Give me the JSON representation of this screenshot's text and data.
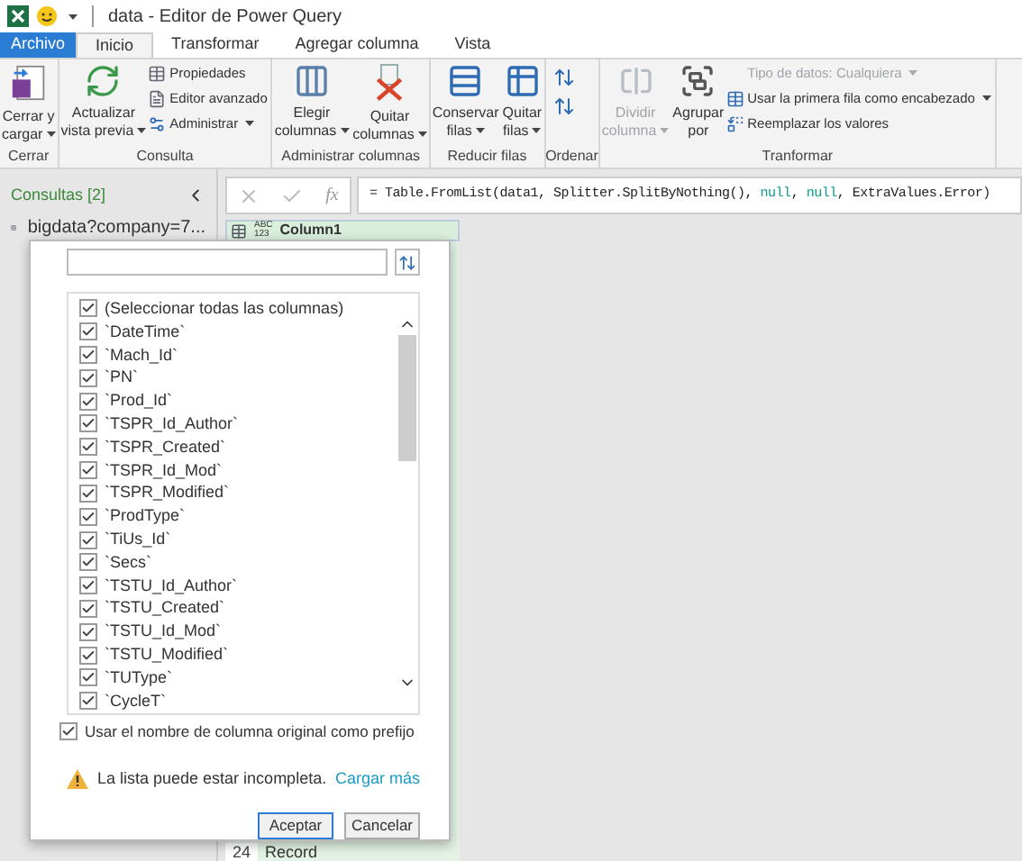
{
  "window": {
    "title": "data - Editor de Power Query"
  },
  "tabs": [
    {
      "label": "Archivo",
      "kind": "file",
      "selected": false
    },
    {
      "label": "Inicio",
      "kind": "tab",
      "selected": true
    },
    {
      "label": "Transformar",
      "kind": "tab",
      "selected": false
    },
    {
      "label": "Agregar columna",
      "kind": "tab",
      "selected": false
    },
    {
      "label": "Vista",
      "kind": "tab",
      "selected": false
    }
  ],
  "ribbon_groups": [
    {
      "label": "Cerrar",
      "buttons": [
        {
          "kind": "large",
          "lines": [
            "Cerrar y",
            "cargar"
          ],
          "dropdown": true,
          "disabled": false
        }
      ]
    },
    {
      "label": "Consulta",
      "buttons": [
        {
          "kind": "large",
          "lines": [
            "Actualizar",
            "vista previa"
          ],
          "dropdown": true,
          "disabled": false
        },
        {
          "kind": "stack",
          "items": [
            {
              "label": "Propiedades",
              "dropdown": false,
              "disabled": false
            },
            {
              "label": "Editor avanzado",
              "dropdown": false,
              "disabled": false
            },
            {
              "label": "Administrar",
              "dropdown": true,
              "disabled": false
            }
          ]
        }
      ]
    },
    {
      "label": "Administrar columnas",
      "buttons": [
        {
          "kind": "large",
          "lines": [
            "Elegir",
            "columnas"
          ],
          "dropdown": true,
          "disabled": false
        },
        {
          "kind": "large",
          "lines": [
            "Quitar",
            "columnas"
          ],
          "dropdown": true,
          "disabled": false
        }
      ]
    },
    {
      "label": "Reducir filas",
      "buttons": [
        {
          "kind": "large",
          "lines": [
            "Conservar",
            "filas"
          ],
          "dropdown": true,
          "disabled": false
        },
        {
          "kind": "large",
          "lines": [
            "Quitar",
            "filas"
          ],
          "dropdown": true,
          "disabled": false
        }
      ]
    },
    {
      "label": "Ordenar",
      "buttons": [
        {
          "kind": "sort"
        }
      ]
    },
    {
      "label": "Tranformar",
      "buttons": [
        {
          "kind": "large",
          "lines": [
            "Dividir",
            "columna"
          ],
          "dropdown": true,
          "disabled": true
        },
        {
          "kind": "large",
          "lines": [
            "Agrupar",
            "por"
          ],
          "dropdown": false,
          "disabled": false
        },
        {
          "kind": "stack",
          "items": [
            {
              "label": "Tipo de datos: Cualquiera",
              "dropdown": true,
              "disabled": true
            },
            {
              "label": "Usar la primera fila como encabezado",
              "dropdown": true,
              "disabled": false
            },
            {
              "label": "Reemplazar los valores",
              "dropdown": false,
              "disabled": false
            }
          ]
        }
      ]
    }
  ],
  "queries": {
    "title": "Consultas [2]",
    "items": [
      {
        "label": "bigdata?company=7..."
      }
    ]
  },
  "formula_bar": {
    "function_label": "fx",
    "parts": [
      {
        "text": "= Table.FromList(data1, Splitter.SplitByNothing(), ",
        "kind": "plain"
      },
      {
        "text": "null",
        "kind": "keyword"
      },
      {
        "text": ", ",
        "kind": "plain"
      },
      {
        "text": "null",
        "kind": "keyword"
      },
      {
        "text": ", ExtraValues.Error)",
        "kind": "plain"
      }
    ]
  },
  "column": {
    "type": "ABC\n123",
    "name": "Column1"
  },
  "rows": [
    {
      "index": "24",
      "value": "Record"
    }
  ],
  "expand_dialog": {
    "columns": [
      {
        "label": "(Seleccionar todas las columnas)",
        "checked": true
      },
      {
        "label": "`DateTime`",
        "checked": true
      },
      {
        "label": "`Mach_Id`",
        "checked": true
      },
      {
        "label": "`PN`",
        "checked": true
      },
      {
        "label": "`Prod_Id`",
        "checked": true
      },
      {
        "label": "`TSPR_Id_Author`",
        "checked": true
      },
      {
        "label": "`TSPR_Created`",
        "checked": true
      },
      {
        "label": "`TSPR_Id_Mod`",
        "checked": true
      },
      {
        "label": "`TSPR_Modified`",
        "checked": true
      },
      {
        "label": "`ProdType`",
        "checked": true
      },
      {
        "label": "`TiUs_Id`",
        "checked": true
      },
      {
        "label": "`Secs`",
        "checked": true
      },
      {
        "label": "`TSTU_Id_Author`",
        "checked": true
      },
      {
        "label": "`TSTU_Created`",
        "checked": true
      },
      {
        "label": "`TSTU_Id_Mod`",
        "checked": true
      },
      {
        "label": "`TSTU_Modified`",
        "checked": true
      },
      {
        "label": "`TUType`",
        "checked": true
      },
      {
        "label": "`CycleT`",
        "checked": true
      }
    ],
    "prefix": {
      "label": "Usar el nombre de columna original como prefijo",
      "checked": true
    },
    "warning": "La lista puede estar incompleta.",
    "load_more": "Cargar más",
    "buttons": [
      {
        "label": "Aceptar",
        "kind": "primary"
      },
      {
        "label": "Cancelar",
        "kind": "secondary"
      }
    ]
  }
}
